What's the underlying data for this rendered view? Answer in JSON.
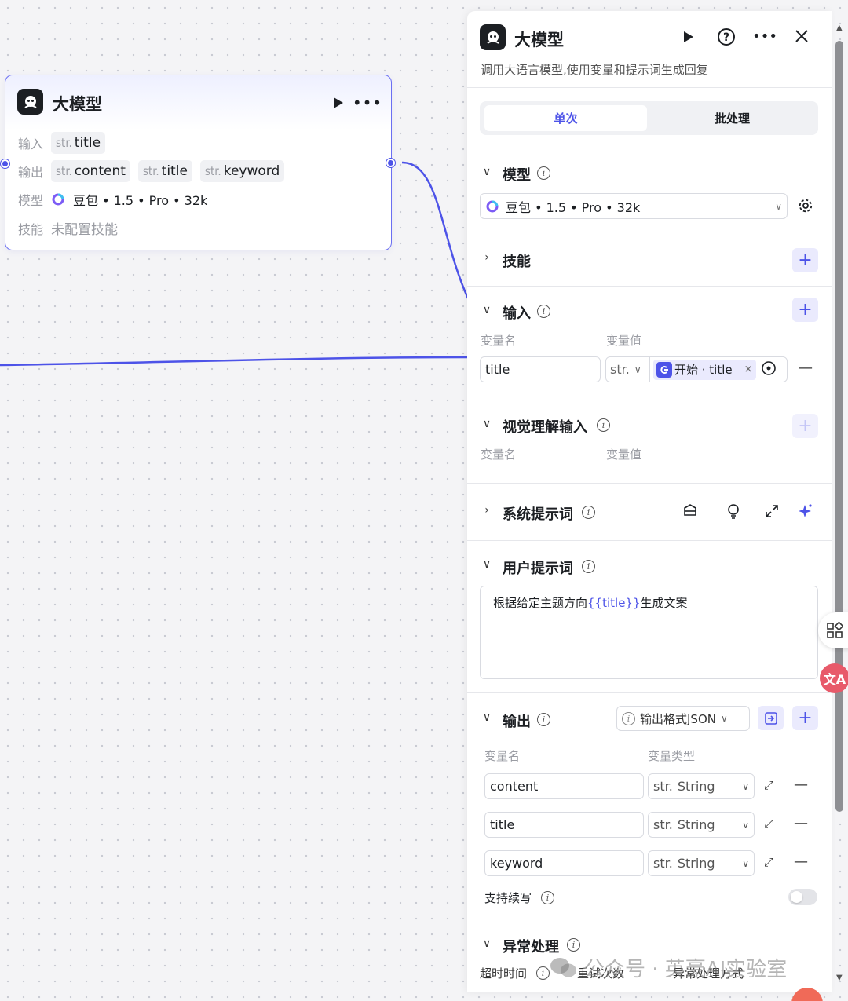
{
  "node": {
    "title": "大模型",
    "rows": [
      {
        "label": "输入",
        "chips": [
          {
            "type": "str.",
            "name": "title"
          }
        ]
      },
      {
        "label": "输出",
        "chips": [
          {
            "type": "str.",
            "name": "content"
          },
          {
            "type": "str.",
            "name": "title"
          },
          {
            "type": "str.",
            "name": "keyword"
          }
        ]
      }
    ],
    "model_label": "模型",
    "model_value": "豆包 • 1.5 • Pro • 32k",
    "skill_label": "技能",
    "skill_value": "未配置技能"
  },
  "panel": {
    "title": "大模型",
    "description": "调用大语言模型,使用变量和提示词生成回复",
    "tabs": [
      "单次",
      "批处理"
    ],
    "model": {
      "title": "模型",
      "value": "豆包 • 1.5 • Pro • 32k"
    },
    "skills": {
      "title": "技能"
    },
    "input": {
      "title": "输入",
      "col_name": "变量名",
      "col_value": "变量值",
      "var_name": "title",
      "var_type": "str.",
      "ref_label": "开始 · title"
    },
    "vision": {
      "title": "视觉理解输入",
      "col_name": "变量名",
      "col_value": "变量值"
    },
    "system_prompt": {
      "title": "系统提示词"
    },
    "user_prompt": {
      "title": "用户提示词",
      "text_before": "根据给定主题方向",
      "text_var": "{{title}}",
      "text_after": "生成文案"
    },
    "output": {
      "title": "输出",
      "format": "输出格式JSON",
      "col_name": "变量名",
      "col_type": "变量类型",
      "vars": [
        {
          "name": "content",
          "type": "String"
        },
        {
          "name": "title",
          "type": "String"
        },
        {
          "name": "keyword",
          "type": "String"
        }
      ],
      "type_prefix": "str.",
      "continue_label": "支持续写"
    },
    "exception": {
      "title": "异常处理",
      "timeout_label": "超时时间",
      "retry_label": "重试次数",
      "method_label": "异常处理方式"
    }
  },
  "watermark": "公众号 · 英豪AI实验室",
  "colors": {
    "accent": "#4d53e8",
    "accent_bg": "#eaeafd",
    "border": "#d9dbe1"
  }
}
